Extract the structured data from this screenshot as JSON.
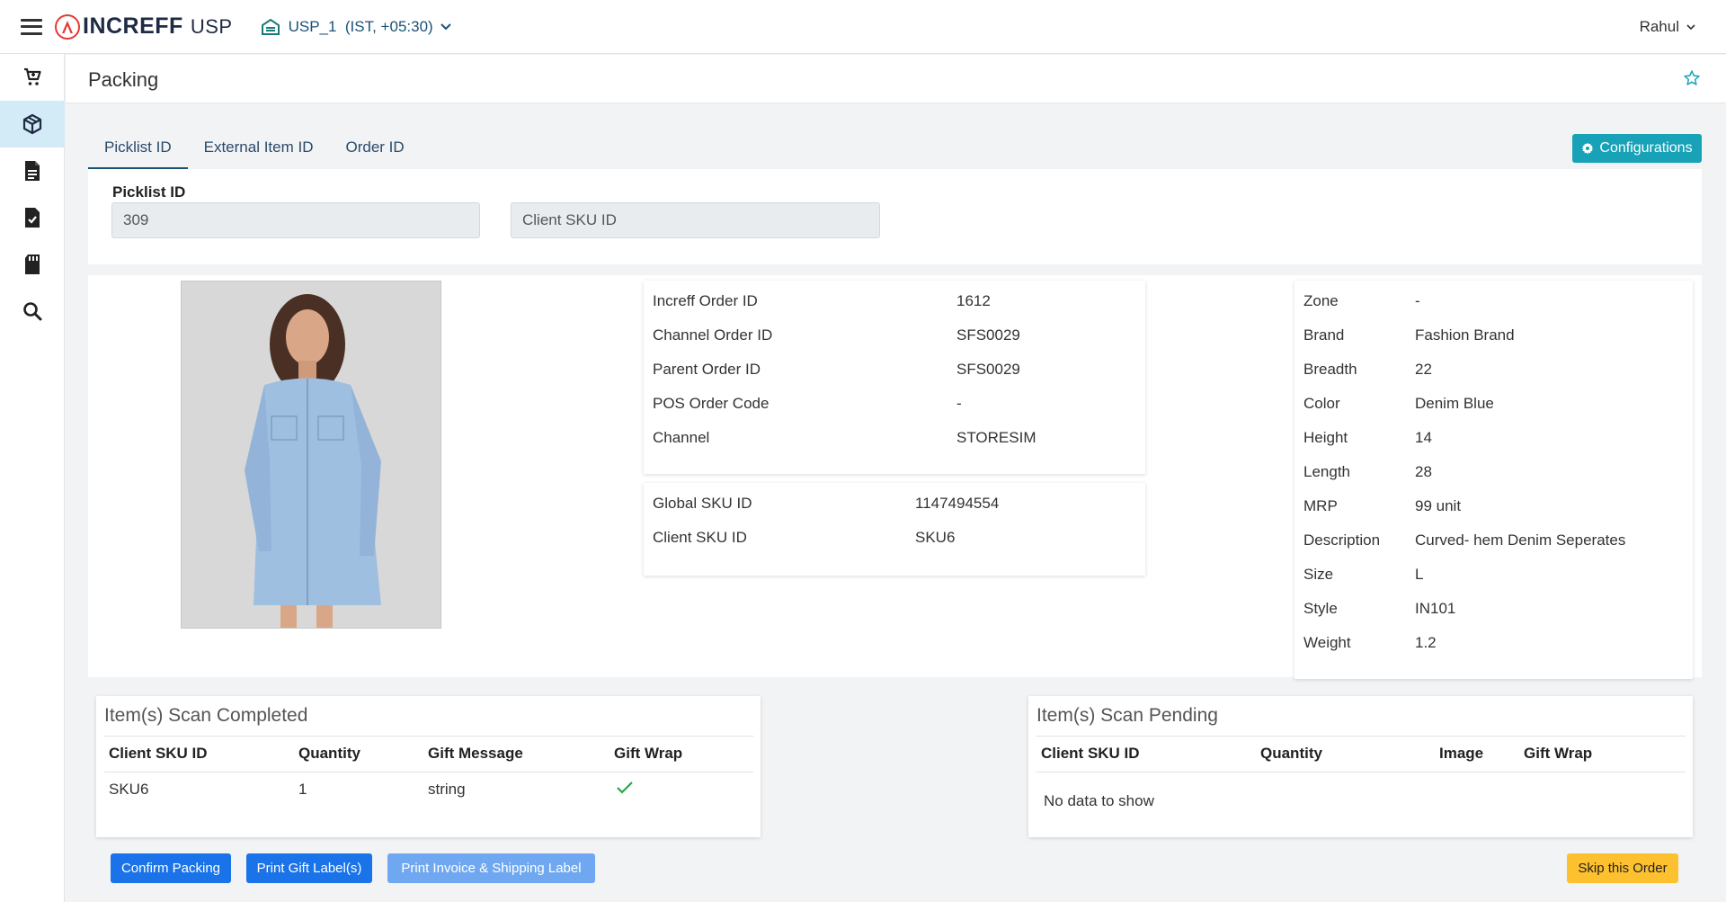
{
  "header": {
    "logo_text": "INCREFF",
    "app_name": "USP",
    "location": "USP_1  (IST, +05:30)",
    "user": "Rahul"
  },
  "sidebar": {
    "items": [
      {
        "name": "cart-icon",
        "active": false
      },
      {
        "name": "box-icon",
        "active": true
      },
      {
        "name": "document-icon",
        "active": false
      },
      {
        "name": "document-check-icon",
        "active": false
      },
      {
        "name": "sd-card-icon",
        "active": false
      },
      {
        "name": "search-icon",
        "active": false
      }
    ]
  },
  "page": {
    "title": "Packing"
  },
  "tabs": [
    {
      "label": "Picklist ID",
      "active": true
    },
    {
      "label": "External Item ID",
      "active": false
    },
    {
      "label": "Order ID",
      "active": false
    }
  ],
  "configurations_label": "Configurations",
  "scan": {
    "picklist_label": "Picklist ID",
    "picklist_value": "309",
    "sku_placeholder": "Client SKU ID"
  },
  "order_info": [
    {
      "label": "Increff Order ID",
      "value": "1612"
    },
    {
      "label": "Channel Order ID",
      "value": "SFS0029"
    },
    {
      "label": "Parent Order ID",
      "value": "SFS0029"
    },
    {
      "label": "POS Order Code",
      "value": "-"
    },
    {
      "label": "Channel",
      "value": "STORESIM"
    }
  ],
  "sku_info": [
    {
      "label": "Global SKU ID",
      "value": "1147494554"
    },
    {
      "label": "Client SKU ID",
      "value": "SKU6"
    }
  ],
  "attributes": [
    {
      "label": "Zone",
      "value": "-"
    },
    {
      "label": "Brand",
      "value": "Fashion Brand"
    },
    {
      "label": "Breadth",
      "value": "22"
    },
    {
      "label": "Color",
      "value": "Denim Blue"
    },
    {
      "label": "Height",
      "value": "14"
    },
    {
      "label": "Length",
      "value": "28"
    },
    {
      "label": "MRP",
      "value": "99 unit"
    },
    {
      "label": "Description",
      "value": "Curved- hem Denim Seperates"
    },
    {
      "label": "Size",
      "value": "L"
    },
    {
      "label": "Style",
      "value": "IN101"
    },
    {
      "label": "Weight",
      "value": "1.2"
    }
  ],
  "completed": {
    "title": "Item(s) Scan Completed",
    "columns": [
      "Client SKU ID",
      "Quantity",
      "Gift Message",
      "Gift Wrap"
    ],
    "rows": [
      {
        "sku": "SKU6",
        "quantity": "1",
        "gift_message": "string",
        "gift_wrap": true
      }
    ]
  },
  "pending": {
    "title": "Item(s) Scan Pending",
    "columns": [
      "Client SKU ID",
      "Quantity",
      "Image",
      "Gift Wrap"
    ],
    "empty_text": "No data to show"
  },
  "buttons": {
    "confirm": "Confirm Packing",
    "gift_label": "Print Gift Label(s)",
    "invoice": "Print Invoice & Shipping Label",
    "skip": "Skip this Order"
  },
  "colors": {
    "primary": "#1a73e8",
    "primary_light": "#6fa8f0",
    "info": "#17a2b8",
    "warning": "#fdc02f",
    "success": "#28a745",
    "brand_red": "#e53935",
    "active_side": "#d3ebf7"
  }
}
